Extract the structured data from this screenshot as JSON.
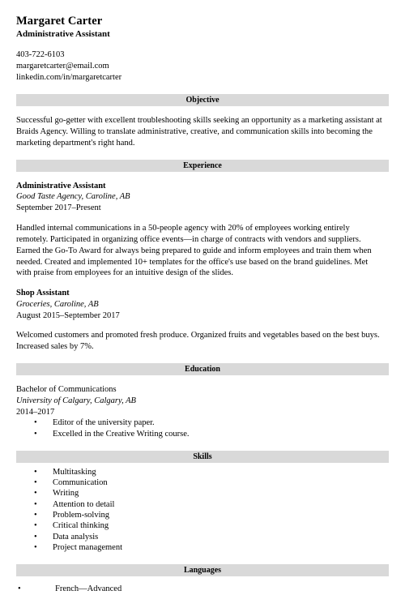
{
  "document": {
    "type": "resume",
    "accent_bar_color": "#d9d9d9",
    "text_color": "#000000",
    "background_color": "#ffffff"
  },
  "header": {
    "name": "Margaret Carter",
    "job_title": "Administrative Assistant",
    "contact": {
      "phone": "403-722-6103",
      "email": "margaretcarter@email.com",
      "linkedin": "linkedin.com/in/margaretcarter"
    }
  },
  "sections": {
    "objective": {
      "heading": "Objective",
      "text": "Successful go-getter with excellent troubleshooting skills seeking an opportunity as a marketing assistant at Braids Agency. Willing to translate administrative, creative, and communication skills into becoming the marketing department's right hand."
    },
    "experience": {
      "heading": "Experience",
      "entries": [
        {
          "title": "Administrative Assistant",
          "organization": "Good Taste Agency, Caroline, AB",
          "dates": "September 2017–Present",
          "description": "Handled internal communications in a 50-people agency with 20% of employees working entirely remotely. Participated in organizing office events—in charge of contracts with vendors and suppliers. Earned the Go-To Award for always being prepared to guide and inform employees and train them when needed. Created and implemented 10+ templates for the office's use based on the brand guidelines. Met with praise from employees for an intuitive design of the slides."
        },
        {
          "title": "Shop Assistant",
          "organization": "Groceries, Caroline, AB",
          "dates": "August 2015–September 2017",
          "description": "Welcomed customers and promoted fresh produce. Organized fruits and vegetables based on the best buys. Increased sales by 7%."
        }
      ]
    },
    "education": {
      "heading": "Education",
      "degree": "Bachelor of Communications",
      "school": "University of Calgary, Calgary, AB",
      "years": "2014–2017",
      "bullets": [
        "Editor of the university paper.",
        "Excelled in the Creative Writing course."
      ]
    },
    "skills": {
      "heading": "Skills",
      "items": [
        "Multitasking",
        "Communication",
        "Writing",
        "Attention to detail",
        "Problem-solving",
        "Critical thinking",
        "Data analysis",
        "Project management"
      ]
    },
    "languages": {
      "heading": "Languages",
      "items": [
        "French—Advanced"
      ]
    }
  },
  "bullet_glyph": "•"
}
